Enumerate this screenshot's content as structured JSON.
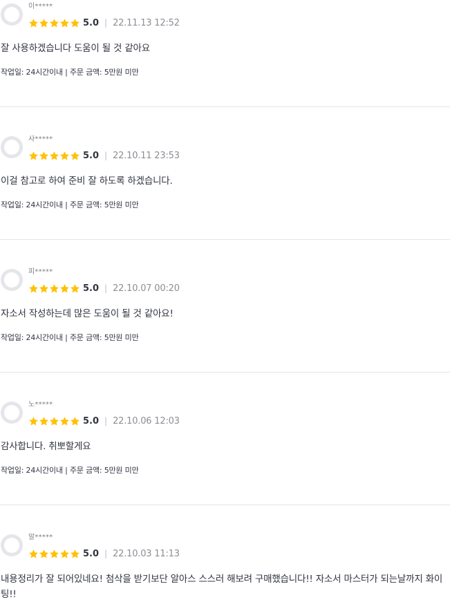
{
  "colors": {
    "star": "#ffc107",
    "text": "#303441",
    "muted": "#8c8e95",
    "divider": "#e4e5ea",
    "avatar": "#e5e6ea"
  },
  "reviews": [
    {
      "nickname": "이*****",
      "score": "5.0",
      "separator": "|",
      "date": "22.11.13 12:52",
      "content": "잘 사용하겠습니다 도움이 될 것 같아요",
      "meta": "작업일: 24시간이내 | 주문 금액: 5만원 미만",
      "stars": 5
    },
    {
      "nickname": "사*****",
      "score": "5.0",
      "separator": "|",
      "date": "22.10.11 23:53",
      "content": "이걸 참고로 하여 준비 잘 하도록 하겠습니다.",
      "meta": "작업일: 24시간이내 | 주문 금액: 5만원 미만",
      "stars": 5
    },
    {
      "nickname": "피*****",
      "score": "5.0",
      "separator": "|",
      "date": "22.10.07 00:20",
      "content": "자소서 작성하는데 많은 도움이 될 것 같아요!",
      "meta": "작업일: 24시간이내 | 주문 금액: 5만원 미만",
      "stars": 5
    },
    {
      "nickname": "노*****",
      "score": "5.0",
      "separator": "|",
      "date": "22.10.06 12:03",
      "content": "감사합니다. 취뽀할게요",
      "meta": "작업일: 24시간이내 | 주문 금액: 5만원 미만",
      "stars": 5
    },
    {
      "nickname": "알*****",
      "score": "5.0",
      "separator": "|",
      "date": "22.10.03 11:13",
      "content": "내용정리가 잘 되어있네요! 첨삭을 받기보단 알아스 스스러 해보려 구매했습니다!! 자소서 마스터가 되는날까지 화이팅!!",
      "stars": 5
    }
  ]
}
